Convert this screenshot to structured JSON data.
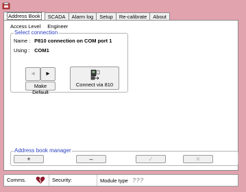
{
  "tabs": [
    {
      "label": "Address Book"
    },
    {
      "label": "SCADA"
    },
    {
      "label": "Alarm log"
    },
    {
      "label": "Setup"
    },
    {
      "label": "Re-calibrate"
    },
    {
      "label": "About"
    }
  ],
  "access": {
    "label": "Access Level",
    "value": "Engineer"
  },
  "select_connection": {
    "title": "Select connection",
    "name_label": "Name :",
    "name_value": "P810 connection on COM port 1",
    "using_label": "Using :",
    "using_value": "COM1",
    "prev_glyph": "◂",
    "next_glyph": "▸",
    "make_default_label": "Make Default",
    "connect_label": "Connect via 810"
  },
  "address_book_manager": {
    "title": "Address book manager",
    "add_label": "+",
    "remove_label": "–",
    "confirm_label": "✓",
    "cancel_label": "✕"
  },
  "status": {
    "comms_label": "Comms.",
    "security_label": "Security:",
    "module_type_label": "Module type",
    "module_type_value": "???"
  },
  "colors": {
    "window_bg": "#e1a3ae",
    "group_title": "#2a3fc1",
    "broken_heart": "#8b1a2a"
  }
}
